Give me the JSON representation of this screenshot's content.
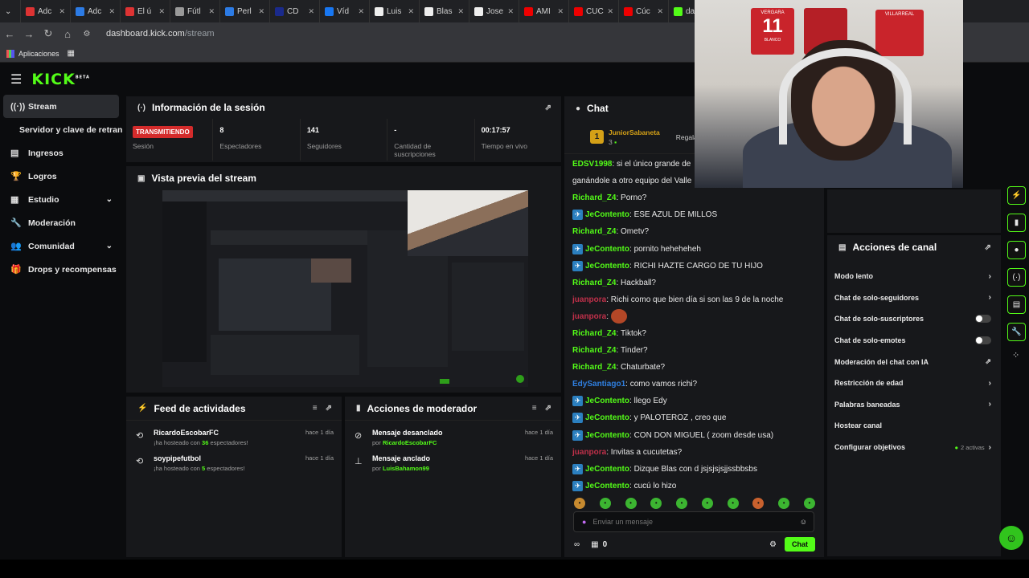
{
  "browser": {
    "tabs": [
      {
        "label": "Adc",
        "color": "#d33"
      },
      {
        "label": "Adc",
        "color": "#2c7be5"
      },
      {
        "label": "El ú",
        "color": "#d33"
      },
      {
        "label": "Fútl",
        "color": "#999"
      },
      {
        "label": "Perl",
        "color": "#2c7be5"
      },
      {
        "label": "CD",
        "color": "#1a2a8c"
      },
      {
        "label": "Víd",
        "color": "#1877f2"
      },
      {
        "label": "Luis",
        "color": "#eee"
      },
      {
        "label": "Blas",
        "color": "#eee"
      },
      {
        "label": "Jose",
        "color": "#eee"
      },
      {
        "label": "AMI",
        "color": "#e00"
      },
      {
        "label": "CUC",
        "color": "#e00"
      },
      {
        "label": "Cúc",
        "color": "#e00"
      },
      {
        "label": "das",
        "color": "#53fc18"
      }
    ],
    "url_host": "dashboard.kick.com",
    "url_path": "/stream",
    "bookmarks_label": "Aplicaciones"
  },
  "header": {
    "logo": "KICK",
    "beta": "BETA"
  },
  "sidebar": {
    "items": [
      {
        "label": "Stream",
        "icon": "broadcast-icon"
      },
      {
        "label": "Servidor y clave de retransmisión"
      },
      {
        "label": "Ingresos",
        "icon": "chart-icon"
      },
      {
        "label": "Logros",
        "icon": "trophy-icon"
      },
      {
        "label": "Estudio",
        "icon": "grid-icon"
      },
      {
        "label": "Moderación",
        "icon": "wrench-icon"
      },
      {
        "label": "Comunidad",
        "icon": "people-icon"
      },
      {
        "label": "Drops y recompensas",
        "icon": "gift-icon"
      }
    ]
  },
  "session": {
    "title": "Información de la sesión",
    "live_badge": "TRANSMITIENDO",
    "stats": [
      {
        "value": "",
        "label": "Sesión"
      },
      {
        "value": "8",
        "label": "Espectadores"
      },
      {
        "value": "141",
        "label": "Seguidores"
      },
      {
        "value": "-",
        "label": "Cantidad de suscripciones"
      },
      {
        "value": "00:17:57",
        "label": "Tiempo en vivo"
      }
    ]
  },
  "preview": {
    "title": "Vista previa del stream"
  },
  "feed": {
    "title": "Feed de actividades",
    "items": [
      {
        "name": "RicardoEscobarFC",
        "pre": "¡ha hosteado con ",
        "count": "36",
        "post": " espectadores!",
        "time": "hace 1 día"
      },
      {
        "name": "soypipefutbol",
        "pre": "¡ha hosteado con ",
        "count": "5",
        "post": " espectadores!",
        "time": "hace 1 día"
      }
    ]
  },
  "mod": {
    "title": "Acciones de moderador",
    "items": [
      {
        "action": "Mensaje desanclado",
        "by": "por ",
        "user": "RicardoEscobarFC",
        "time": "hace 1 día"
      },
      {
        "action": "Mensaje anclado",
        "by": "por ",
        "user": "LuisBahamon99",
        "time": "hace 1 día"
      }
    ]
  },
  "chat": {
    "title": "Chat",
    "pinned_user": "JuniorSabaneta",
    "pinned_sub": "3",
    "pinned_extra": "Regala",
    "messages": [
      {
        "user": "EDSV1998",
        "color": "#53fc18",
        "text": "si el único grande de",
        "badge": false
      },
      {
        "user": "",
        "color": "#53fc18",
        "text": "ganándole a otro equipo del Valle",
        "badge": false
      },
      {
        "user": "Richard_Z4",
        "color": "#53fc18",
        "text": "Porno?",
        "badge": false
      },
      {
        "user": "JeContento",
        "color": "#53fc18",
        "text": "ESE AZUL DE MILLOS",
        "badge": true
      },
      {
        "user": "Richard_Z4",
        "color": "#53fc18",
        "text": "Ometv?",
        "badge": false
      },
      {
        "user": "JeContento",
        "color": "#53fc18",
        "text": "pornito heheheheh",
        "badge": true
      },
      {
        "user": "JeContento",
        "color": "#53fc18",
        "text": "RICHI HAZTE CARGO DE TU HIJO",
        "badge": true
      },
      {
        "user": "Richard_Z4",
        "color": "#53fc18",
        "text": "Hackball?",
        "badge": false
      },
      {
        "user": "juanpora",
        "color": "#c0304a",
        "text": "Richi como que bien día si son las 9 de la noche",
        "badge": false
      },
      {
        "user": "juanpora",
        "color": "#c0304a",
        "text": "",
        "badge": false,
        "emoji": true
      },
      {
        "user": "Richard_Z4",
        "color": "#53fc18",
        "text": "Tiktok?",
        "badge": false
      },
      {
        "user": "Richard_Z4",
        "color": "#53fc18",
        "text": "Tinder?",
        "badge": false
      },
      {
        "user": "Richard_Z4",
        "color": "#53fc18",
        "text": "Chaturbate?",
        "badge": false
      },
      {
        "user": "EdySantiago1",
        "color": "#2f7fe0",
        "text": "como vamos richi?",
        "badge": false
      },
      {
        "user": "JeContento",
        "color": "#53fc18",
        "text": "llego Edy",
        "badge": true
      },
      {
        "user": "JeContento",
        "color": "#53fc18",
        "text": "y PALOTEROZ , creo que",
        "badge": true
      },
      {
        "user": "JeContento",
        "color": "#53fc18",
        "text": "CON DON MIGUEL ( zoom desde usa)",
        "badge": true
      },
      {
        "user": "juanpora",
        "color": "#c0304a",
        "text": "Invitas a cucutetas?",
        "badge": false
      },
      {
        "user": "JeContento",
        "color": "#53fc18",
        "text": "Dizque Blas con d jsjsjsjsjjssbbsbs",
        "badge": true
      },
      {
        "user": "JeContento",
        "color": "#53fc18",
        "text": "cucú lo hizo",
        "badge": true
      }
    ],
    "input_placeholder": "Enviar un mensaje",
    "points": "0",
    "send_label": "Chat"
  },
  "channel": {
    "title": "Acciones de canal",
    "items": [
      {
        "label": "Modo lento",
        "control": "chevron"
      },
      {
        "label": "Chat de solo-seguidores",
        "control": "chevron"
      },
      {
        "label": "Chat de solo-suscriptores",
        "control": "toggle"
      },
      {
        "label": "Chat de solo-emotes",
        "control": "toggle"
      },
      {
        "label": "Moderación del chat con IA",
        "control": "external"
      },
      {
        "label": "Restricción de edad",
        "control": "chevron"
      },
      {
        "label": "Palabras baneadas",
        "control": "chevron"
      },
      {
        "label": "Hostear canal",
        "control": "none"
      },
      {
        "label": "Configurar objetivos",
        "control": "chevron",
        "status": "2 activas"
      }
    ]
  },
  "webcam": {
    "jerseys": [
      {
        "name": "VERGARA",
        "number": "11"
      },
      {
        "name": "VILLARREAL",
        "number": ""
      }
    ],
    "jersey_sub": "BLANCO"
  },
  "colors": {
    "brand": "#53fc18",
    "live": "#d42b2b",
    "panel": "#17181b"
  }
}
